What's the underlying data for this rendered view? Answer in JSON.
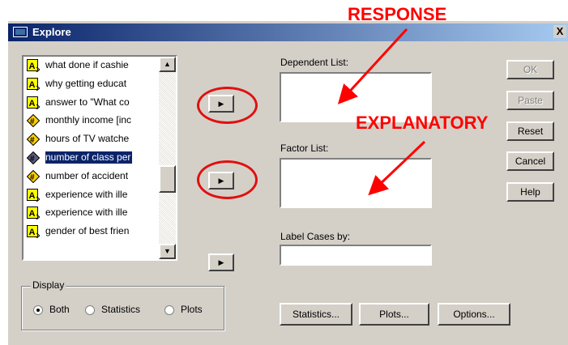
{
  "window": {
    "title": "Explore",
    "close_glyph": "X"
  },
  "variables": [
    {
      "label": "what done if cashie",
      "icon": "string-icon",
      "selected": false
    },
    {
      "label": "why getting educat",
      "icon": "string-icon",
      "selected": false
    },
    {
      "label": "answer to \"What co",
      "icon": "string-icon",
      "selected": false
    },
    {
      "label": "monthly income [inc",
      "icon": "numeric-icon",
      "selected": false
    },
    {
      "label": "hours of TV watche",
      "icon": "numeric-icon",
      "selected": false
    },
    {
      "label": "number of class per",
      "icon": "numeric-icon",
      "selected": true
    },
    {
      "label": "number of accident",
      "icon": "numeric-icon",
      "selected": false
    },
    {
      "label": "experience with ille",
      "icon": "string-icon",
      "selected": false
    },
    {
      "label": "experience with ille",
      "icon": "string-icon",
      "selected": false
    },
    {
      "label": "gender of best frien",
      "icon": "string-icon",
      "selected": false
    }
  ],
  "fields": {
    "dependent_label": "Dependent List:",
    "factor_label": "Factor List:",
    "label_cases_label": "Label Cases by:"
  },
  "buttons": {
    "ok": "OK",
    "paste": "Paste",
    "reset": "Reset",
    "cancel": "Cancel",
    "help": "Help",
    "statistics": "Statistics...",
    "plots": "Plots...",
    "options": "Options..."
  },
  "display": {
    "title": "Display",
    "options": [
      "Both",
      "Statistics",
      "Plots"
    ],
    "selected": "Both"
  },
  "annotations": {
    "response": "RESPONSE",
    "explanatory": "EXPLANATORY"
  },
  "colors": {
    "annotation": "#ff0000",
    "title_bar": "#0a246a",
    "selection": "#0a246a"
  }
}
